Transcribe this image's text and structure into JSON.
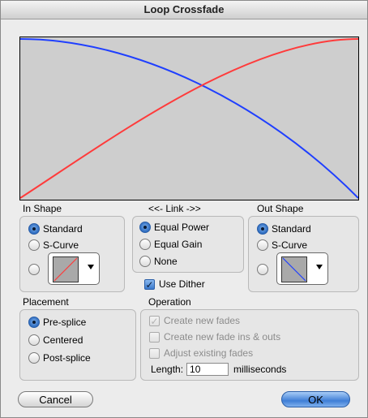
{
  "window": {
    "title": "Loop Crossfade"
  },
  "in_shape": {
    "label": "In Shape",
    "options": [
      "Standard",
      "S-Curve"
    ],
    "selected": "Standard"
  },
  "link": {
    "label": "<<- Link ->>",
    "options": [
      "Equal Power",
      "Equal Gain",
      "None"
    ],
    "selected": "Equal Power",
    "use_dither_label": "Use Dither",
    "use_dither_checked": true
  },
  "out_shape": {
    "label": "Out Shape",
    "options": [
      "Standard",
      "S-Curve"
    ],
    "selected": "Standard"
  },
  "placement": {
    "label": "Placement",
    "options": [
      "Pre-splice",
      "Centered",
      "Post-splice"
    ],
    "selected": "Pre-splice"
  },
  "operation": {
    "label": "Operation",
    "create_new_fades": "Create new fades",
    "create_new_fade_ins_outs": "Create new fade ins & outs",
    "adjust_existing_fades": "Adjust existing fades",
    "length_label": "Length:",
    "length_value": "10",
    "length_unit": "milliseconds"
  },
  "buttons": {
    "cancel": "Cancel",
    "ok": "OK"
  },
  "colors": {
    "fade_in": "#ff3b3b",
    "fade_out": "#1f3fff",
    "graph_bg": "#cecece"
  }
}
